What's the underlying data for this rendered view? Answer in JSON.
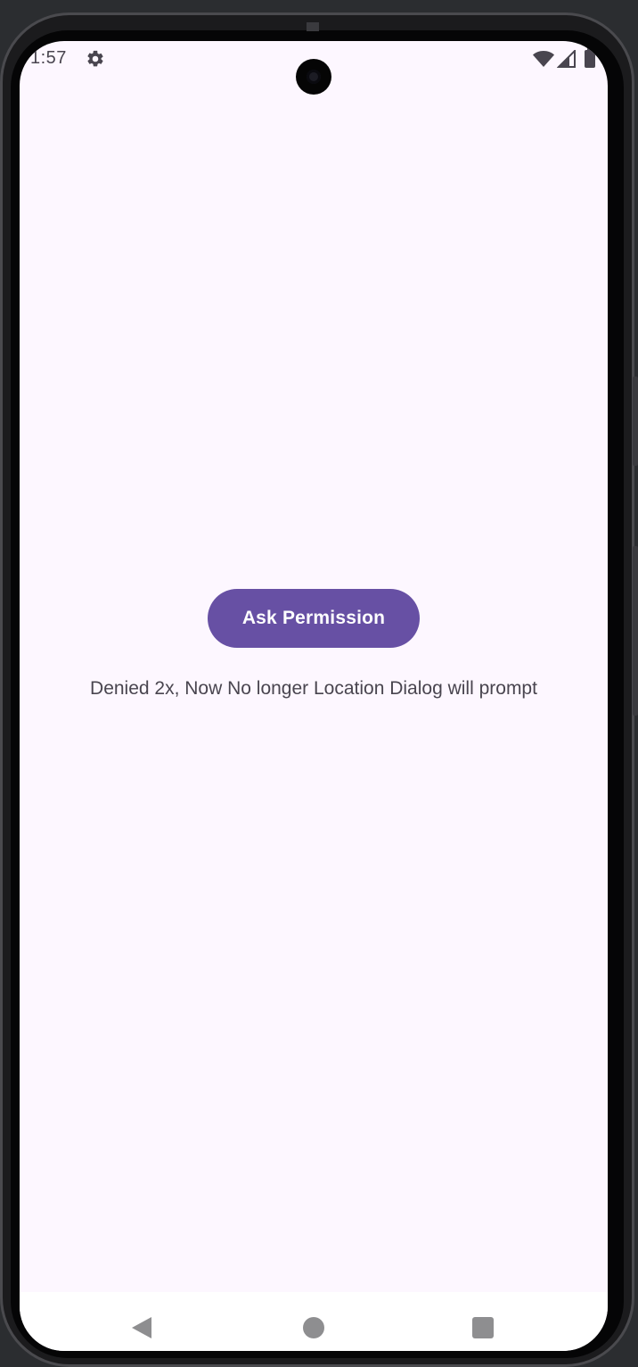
{
  "status_bar": {
    "time": "1:57",
    "settings_icon": "gear-icon",
    "wifi_icon": "wifi-icon",
    "signal_icon": "cell-signal-icon",
    "battery_icon": "battery-icon"
  },
  "main": {
    "ask_button_label": "Ask Permission",
    "message": "Denied 2x, Now No longer Location Dialog will prompt"
  },
  "nav_bar": {
    "back_icon": "back-triangle-icon",
    "home_icon": "home-circle-icon",
    "recents_icon": "recents-square-icon"
  },
  "colors": {
    "accent": "#6750a4",
    "screen_background": "#fdf7ff",
    "text": "#49454f"
  }
}
